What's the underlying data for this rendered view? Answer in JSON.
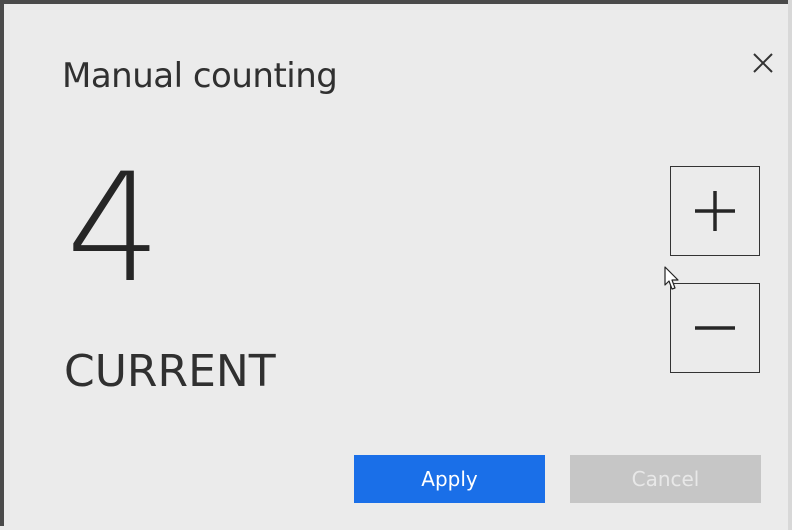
{
  "dialog": {
    "title": "Manual counting",
    "close_icon": "close-icon"
  },
  "counter": {
    "value": "4",
    "label": "CURRENT",
    "increment_icon": "plus-icon",
    "decrement_icon": "minus-icon"
  },
  "actions": {
    "apply_label": "Apply",
    "cancel_label": "Cancel"
  },
  "colors": {
    "background": "#ebebeb",
    "apply": "#1a6fe8",
    "cancel_disabled": "#c6c6c6",
    "text": "#303030"
  }
}
